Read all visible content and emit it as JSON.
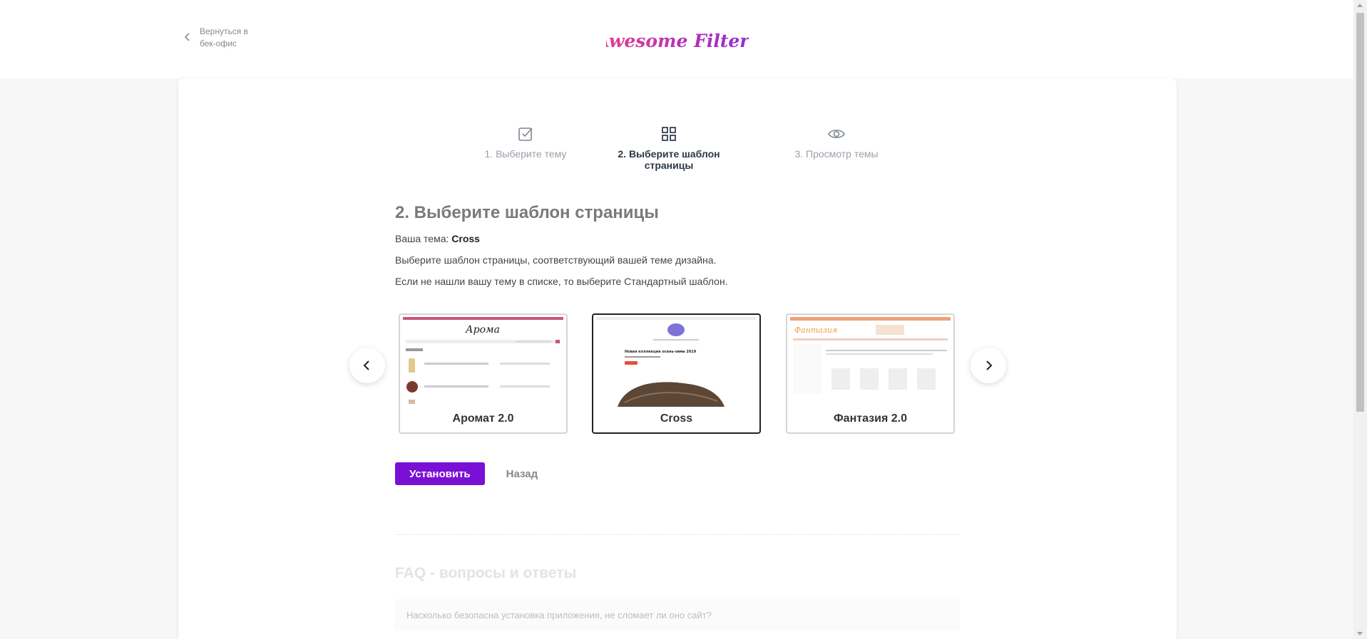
{
  "header": {
    "back_label": "Вернуться в бек-офис",
    "logo_text": "Awesome Filters"
  },
  "steps": [
    {
      "label": "1. Выберите тему",
      "icon": "checkbox-icon",
      "active": false
    },
    {
      "label": "2. Выберите шаблон страницы",
      "icon": "grid-icon",
      "active": true
    },
    {
      "label": "3. Просмотр темы",
      "icon": "eye-icon",
      "active": false
    }
  ],
  "main": {
    "heading": "2. Выберите шаблон страницы",
    "theme_prefix": "Ваша тема:",
    "theme_name": "Cross",
    "description1": "Выберите шаблон страницы, соответствующий вашей теме дизайна.",
    "description2": "Если не нашли вашу тему в списке, то выберите Стандартный шаблон."
  },
  "templates": [
    {
      "name": "Аромат 2.0",
      "selected": false,
      "thumb_logo": "Арома"
    },
    {
      "name": "Cross",
      "selected": true,
      "thumb_headline": "Новая коллекция осень-зима 2019"
    },
    {
      "name": "Фантазия 2.0",
      "selected": false,
      "thumb_logo": "Фантазия"
    }
  ],
  "actions": {
    "install_label": "Установить",
    "back_label": "Назад"
  },
  "faq": {
    "title": "FAQ - вопросы и ответы",
    "items": [
      "Насколько безопасна установка приложения, не сломает ли оно сайт?"
    ]
  },
  "colors": {
    "accent": "#7a0fd6",
    "logo_gradient_start": "#e83e8c",
    "logo_gradient_end": "#8b2bd9"
  }
}
